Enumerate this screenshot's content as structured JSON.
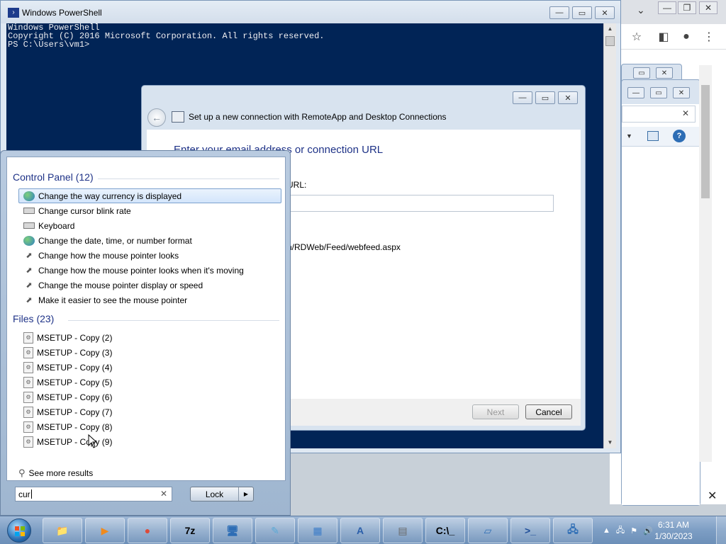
{
  "powershell": {
    "title": "Windows PowerShell",
    "console_lines": [
      "Windows PowerShell",
      "Copyright (C) 2016 Microsoft Corporation. All rights reserved.",
      "",
      "PS C:\\Users\\vm1>"
    ],
    "minimize": "—",
    "maximize": "▭",
    "close": "✕"
  },
  "remoteapp": {
    "title": "Set up a new connection with RemoteApp and Desktop Connections",
    "heading": "Enter your email address or connection URL",
    "label": "URL:",
    "input_value": "",
    "example": "n/RDWeb/Feed/webfeed.aspx",
    "next_label": "Next",
    "cancel_label": "Cancel"
  },
  "start_menu": {
    "control_panel_header": "Control Panel (12)",
    "control_panel_items": [
      {
        "label": "Change the way currency is displayed",
        "icon": "globe-icon"
      },
      {
        "label": "Change cursor blink rate",
        "icon": "keyboard-icon"
      },
      {
        "label": "Keyboard",
        "icon": "keyboard-icon"
      },
      {
        "label": "Change the date, time, or number format",
        "icon": "globe-icon"
      },
      {
        "label": "Change how the mouse pointer looks",
        "icon": "mouse-icon"
      },
      {
        "label": "Change how the mouse pointer looks when it's moving",
        "icon": "mouse-icon"
      },
      {
        "label": "Change the mouse pointer display or speed",
        "icon": "mouse-icon"
      },
      {
        "label": "Make it easier to see the mouse pointer",
        "icon": "mouse-icon"
      }
    ],
    "files_header": "Files (23)",
    "files_items": [
      "MSETUP - Copy (2)",
      "MSETUP - Copy (3)",
      "MSETUP - Copy (4)",
      "MSETUP - Copy (5)",
      "MSETUP - Copy (6)",
      "MSETUP - Copy (7)",
      "MSETUP - Copy (8)",
      "MSETUP - Copy (9)"
    ],
    "see_more": "See more results",
    "search_value": "cur",
    "search_clear": "✕",
    "lock_label": "Lock",
    "lock_arrow": "▶"
  },
  "taskbar": {
    "apps": [
      {
        "name": "explorer",
        "glyph": "📁",
        "color": "#e8b84a"
      },
      {
        "name": "media-player",
        "glyph": "▶",
        "color": "#f08a1c"
      },
      {
        "name": "chrome",
        "glyph": "●",
        "color": "#dd4b39"
      },
      {
        "name": "7zip",
        "glyph": "7z",
        "color": "#000000"
      },
      {
        "name": "computer",
        "glyph": "🖥",
        "color": "#2d6db5"
      },
      {
        "name": "notepad",
        "glyph": "✎",
        "color": "#5aa9d6"
      },
      {
        "name": "control-panel",
        "glyph": "▦",
        "color": "#3a7bc8"
      },
      {
        "name": "wordpad",
        "glyph": "A",
        "color": "#2b5faa"
      },
      {
        "name": "calculator",
        "glyph": "▤",
        "color": "#6a6a6a"
      },
      {
        "name": "cmd",
        "glyph": "C:\\_",
        "color": "#000000"
      },
      {
        "name": "remote-desktop",
        "glyph": "▱",
        "color": "#2d6db5"
      },
      {
        "name": "powershell",
        "glyph": ">_",
        "color": "#1f4e99"
      },
      {
        "name": "network",
        "glyph": "🖧",
        "color": "#2d6db5"
      }
    ],
    "time": "6:31 AM",
    "date": "1/30/2023"
  }
}
